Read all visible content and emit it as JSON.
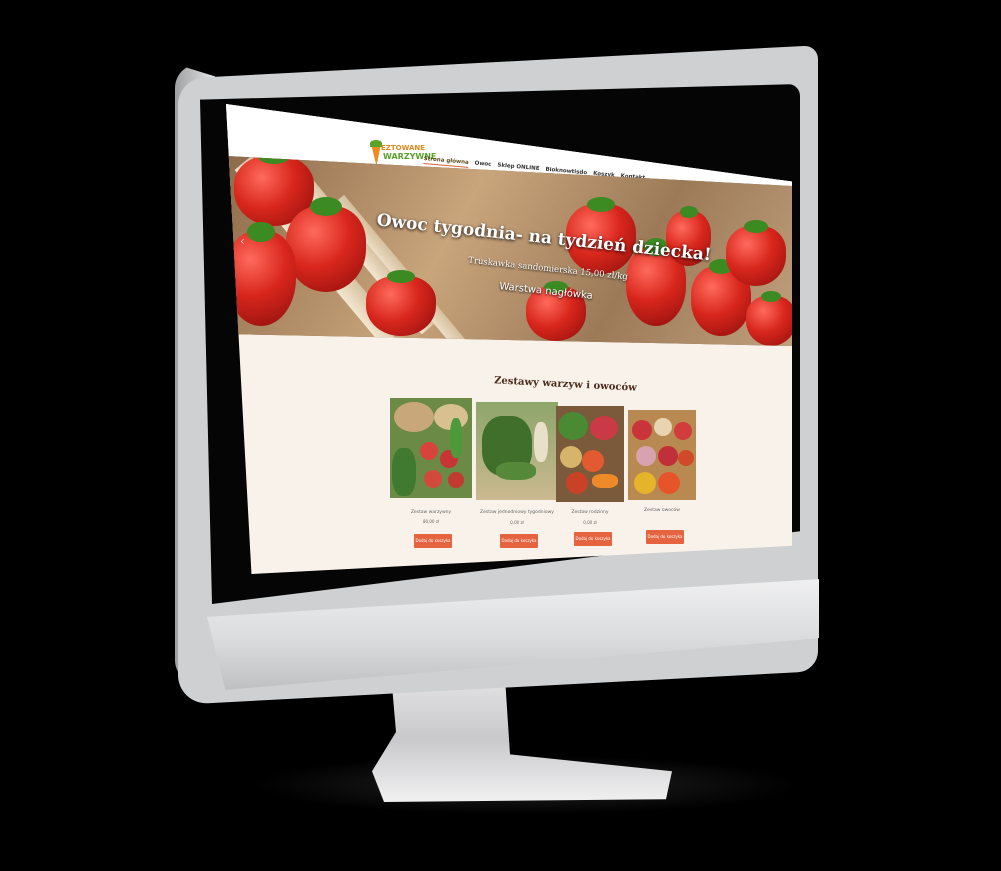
{
  "brand": {
    "logo_line1": "EZTOWANE",
    "logo_line2": "WARZYWNE"
  },
  "nav": {
    "items": [
      {
        "label": "Strona główna",
        "active": true
      },
      {
        "label": "Owoc",
        "active": false
      },
      {
        "label": "Sklep ONLINE",
        "active": false
      },
      {
        "label": "Bioknowtisdo",
        "active": false
      },
      {
        "label": "Koszyk",
        "active": false
      },
      {
        "label": "Kontakt",
        "active": false
      }
    ],
    "search_icon": "search-icon",
    "cart_icon": "cart-icon"
  },
  "hero": {
    "title": "Owoc tygodnia- na tydzień dziecka!",
    "subtitle": "Truskawka sandomierska 15,00 zł/kg",
    "layer_text": "Warstwa nagłówka",
    "prev_arrow": "‹"
  },
  "products_section": {
    "title": "Zestawy warzyw i owoców",
    "items": [
      {
        "name": "Zestaw warzywny",
        "price": "80,00 zł",
        "button": "Dodaj do koszyka"
      },
      {
        "name": "Zestaw jednodniowy tygodniowy",
        "price": "0,00 zł",
        "button": "Dodaj do koszyka"
      },
      {
        "name": "Zestaw rodzinny",
        "price": "0,00 zł",
        "button": "Dodaj do koszyka"
      },
      {
        "name": "Zestaw owoców",
        "price": "",
        "button": "Dodaj do koszyka"
      }
    ]
  },
  "colors": {
    "accent": "#e5633f",
    "page_bg": "#f8f2ea",
    "logo_green": "#5aa22a",
    "logo_orange": "#e38a1e"
  }
}
